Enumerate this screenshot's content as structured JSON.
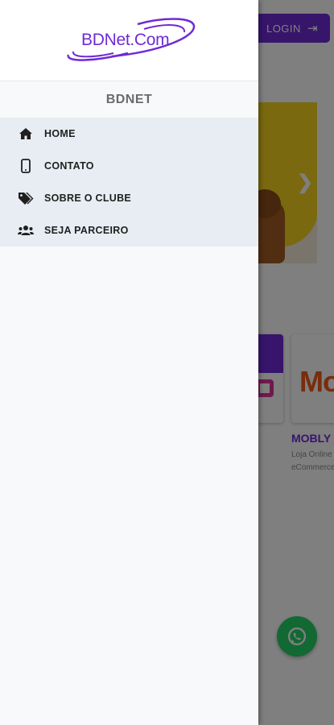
{
  "background": {
    "login_label": "LOGIN",
    "partner_card": {
      "title": "MOBLY",
      "description_line1": "Loja Online",
      "description_line2": "eCommerce"
    },
    "colors": {
      "accent": "#6f2bd6",
      "whatsapp": "#25d366"
    }
  },
  "drawer": {
    "logo_text": "BDNet.Com",
    "title": "BDNET",
    "items": [
      {
        "label": "HOME",
        "icon": "home-icon"
      },
      {
        "label": "CONTATO",
        "icon": "mobile-phone-icon"
      },
      {
        "label": "SOBRE O CLUBE",
        "icon": "tags-icon"
      },
      {
        "label": "SEJA PARCEIRO",
        "icon": "users-icon"
      }
    ]
  }
}
